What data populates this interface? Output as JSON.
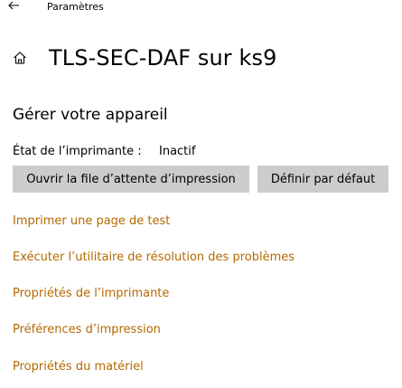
{
  "window": {
    "title": "Paramètres",
    "back_icon": "back-arrow-icon"
  },
  "header": {
    "icon": "home-icon",
    "title": "TLS-SEC-DAF sur ks9"
  },
  "manage": {
    "section_title": "Gérer votre appareil",
    "status_label": "État de l’imprimante :",
    "status_value": "Inactif",
    "buttons": {
      "open_queue": "Ouvrir la file d’attente d’impression",
      "set_default": "Définir par défaut"
    }
  },
  "links": [
    {
      "label": "Imprimer une page de test"
    },
    {
      "label": "Exécuter l’utilitaire de résolution des problèmes"
    },
    {
      "label": "Propriétés de l’imprimante"
    },
    {
      "label": "Préférences d’impression"
    },
    {
      "label": "Propriétés du matériel"
    }
  ],
  "colors": {
    "accent_link": "#b36900",
    "button_bg": "#cccccc"
  }
}
